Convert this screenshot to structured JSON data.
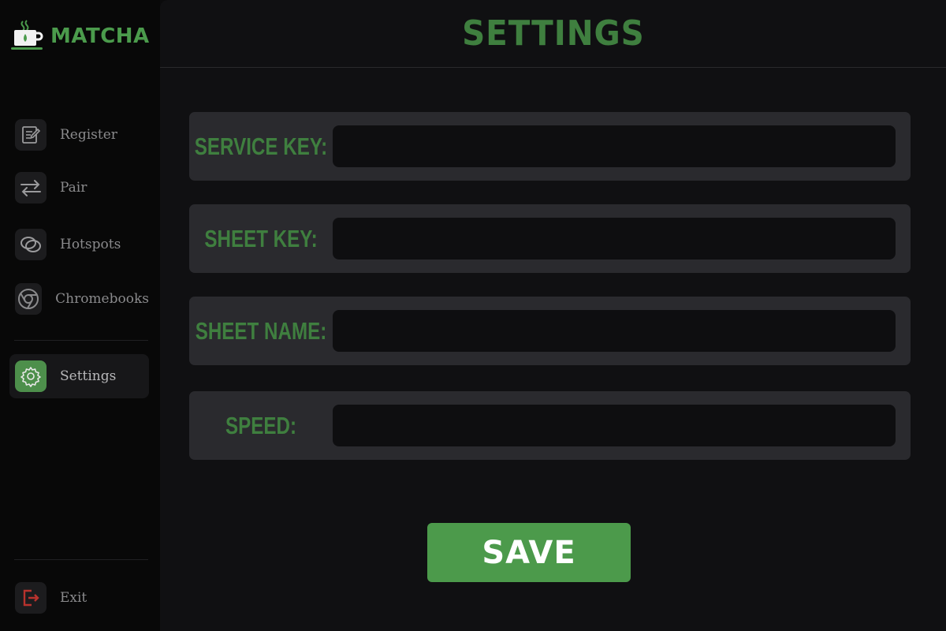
{
  "app": {
    "name": "MATCHA",
    "logo_icon": "matcha-cup-icon"
  },
  "sidebar": {
    "items": [
      {
        "label": "Register",
        "icon": "clipboard-edit-icon"
      },
      {
        "label": "Pair",
        "icon": "swap-arrows-icon"
      },
      {
        "label": "Hotspots",
        "icon": "hotspot-link-icon"
      },
      {
        "label": "Chromebooks",
        "icon": "chrome-icon"
      },
      {
        "label": "Settings",
        "icon": "gear-icon",
        "active": true
      }
    ],
    "exit": {
      "label": "Exit",
      "icon": "exit-icon"
    }
  },
  "page": {
    "title": "SETTINGS"
  },
  "form": {
    "fields": [
      {
        "label": "SERVICE KEY:",
        "value": "",
        "placeholder": ""
      },
      {
        "label": "SHEET KEY:",
        "value": "",
        "placeholder": ""
      },
      {
        "label": "SHEET NAME:",
        "value": "",
        "placeholder": ""
      },
      {
        "label": "SPEED:",
        "value": "",
        "placeholder": ""
      }
    ],
    "save_label": "SAVE"
  },
  "colors": {
    "accent": "#4c9a4b",
    "title_green": "#3f7f3f",
    "exit_red": "#b8322d"
  }
}
